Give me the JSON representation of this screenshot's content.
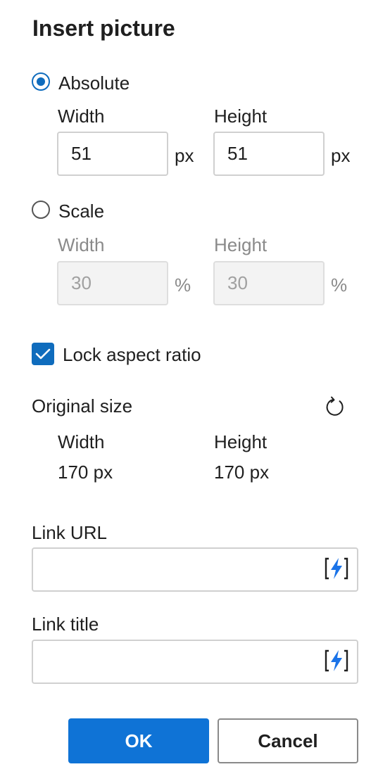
{
  "dialog": {
    "title": "Insert picture"
  },
  "absolute": {
    "label": "Absolute",
    "selected": true,
    "width_label": "Width",
    "height_label": "Height",
    "width_value": "51",
    "height_value": "51",
    "unit": "px"
  },
  "scale": {
    "label": "Scale",
    "selected": false,
    "width_label": "Width",
    "height_label": "Height",
    "width_value": "30",
    "height_value": "30",
    "unit": "%"
  },
  "lock_aspect": {
    "label": "Lock aspect ratio",
    "checked": true
  },
  "original": {
    "label": "Original size",
    "width_label": "Width",
    "height_label": "Height",
    "width_value": "170 px",
    "height_value": "170 px"
  },
  "link_url": {
    "label": "Link URL",
    "value": ""
  },
  "link_title": {
    "label": "Link title",
    "value": ""
  },
  "buttons": {
    "ok": "OK",
    "cancel": "Cancel"
  },
  "colors": {
    "accent": "#0f6cbd",
    "primary_button": "#0f73d6",
    "lightning": "#1a73e8"
  },
  "icons": {
    "reset": "reset-icon",
    "lightning": "lightning-icon"
  }
}
